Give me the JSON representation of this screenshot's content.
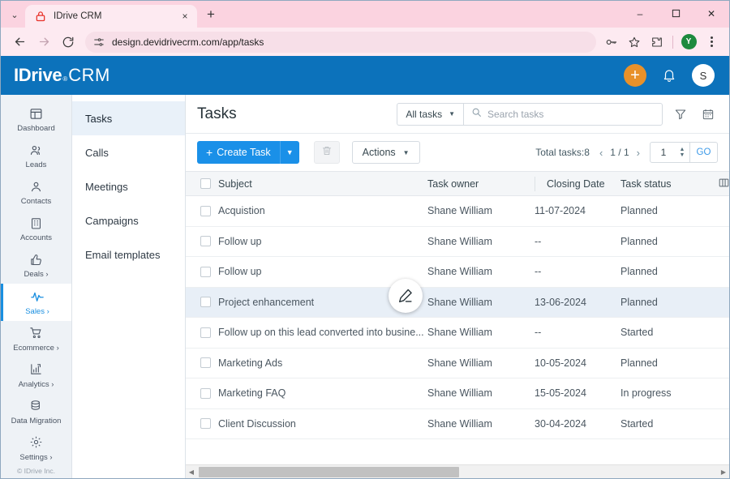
{
  "browser": {
    "tab": {
      "title": "IDrive CRM",
      "favicon": "idrive-lock-icon",
      "close": "×"
    },
    "new_tab": "+",
    "tab_list_chevron": "⌄",
    "window_controls": {
      "minimize": "–",
      "maximize": "☐",
      "close": "✕"
    },
    "nav": {
      "back": "←",
      "forward": "→",
      "reload": "⟳"
    },
    "omnibox": {
      "url": "design.devidrivecrm.com/app/tasks",
      "site_icon": "page-settings-icon"
    },
    "toolbar_icons": {
      "password": "key-icon",
      "bookmark": "star-icon",
      "extensions": "puzzle-icon",
      "profile_initial": "Y",
      "menu": "kebab-icon"
    }
  },
  "app_header": {
    "logo_primary": "IDrive",
    "logo_registered": "®",
    "logo_secondary": "CRM",
    "add_button": "+",
    "notifications_icon": "bell-icon",
    "user_initial": "S",
    "brand_color": "#0c72bb",
    "accent_orange": "#e8912a"
  },
  "sidebar": {
    "items": [
      {
        "label": "Dashboard",
        "icon": "dashboard-icon",
        "active": false,
        "caret": ""
      },
      {
        "label": "Leads",
        "icon": "leads-icon",
        "active": false,
        "caret": ""
      },
      {
        "label": "Contacts",
        "icon": "contacts-icon",
        "active": false,
        "caret": ""
      },
      {
        "label": "Accounts",
        "icon": "accounts-icon",
        "active": false,
        "caret": ""
      },
      {
        "label": "Deals ›",
        "icon": "deals-thumbsup-icon",
        "active": false,
        "caret": "›"
      },
      {
        "label": "Sales ›",
        "icon": "sales-pulse-icon",
        "active": true,
        "caret": "›"
      },
      {
        "label": "Ecommerce ›",
        "icon": "ecommerce-cart-icon",
        "active": false,
        "caret": "›"
      },
      {
        "label": "Analytics ›",
        "icon": "analytics-chart-icon",
        "active": false,
        "caret": "›"
      },
      {
        "label": "Data Migration",
        "icon": "data-migration-icon",
        "active": false,
        "caret": ""
      },
      {
        "label": "Settings ›",
        "icon": "settings-gear-icon",
        "active": false,
        "caret": "›"
      }
    ],
    "footer": "© IDrive Inc."
  },
  "subnav": {
    "items": [
      {
        "label": "Tasks",
        "active": true
      },
      {
        "label": "Calls",
        "active": false
      },
      {
        "label": "Meetings",
        "active": false
      },
      {
        "label": "Campaigns",
        "active": false
      },
      {
        "label": "Email templates",
        "active": false
      }
    ]
  },
  "main": {
    "title": "Tasks",
    "filter_select": {
      "value": "All tasks",
      "caret": "▼"
    },
    "search": {
      "value": "",
      "placeholder": "Search tasks",
      "icon": "search-icon"
    },
    "filter_icon": "funnel-filter-icon",
    "calendar_icon": "calendar-icon",
    "toolbar": {
      "create_label": "Create Task",
      "create_plus": "+",
      "create_caret": "▼",
      "delete_icon": "trash-icon",
      "actions_label": "Actions",
      "actions_caret": "▼"
    },
    "pagination": {
      "total_label": "Total tasks:",
      "total_count": "8",
      "prev": "‹",
      "page_indicator": "1 / 1",
      "next": "›",
      "page_value": "1",
      "spin_up": "▲",
      "spin_down": "▼",
      "go_label": "GO"
    },
    "table": {
      "columns": [
        "Subject",
        "Task owner",
        "Closing Date",
        "Task status"
      ],
      "column_settings_icon": "column-layout-icon",
      "rows": [
        {
          "subject": "Acquistion",
          "owner": "Shane William",
          "closing_date": "11-07-2024",
          "status": "Planned",
          "hovered": false
        },
        {
          "subject": "Follow up",
          "owner": "Shane William",
          "closing_date": "--",
          "status": "Planned",
          "hovered": false
        },
        {
          "subject": "Follow up",
          "owner": "Shane William",
          "closing_date": "--",
          "status": "Planned",
          "hovered": false
        },
        {
          "subject": "Project enhancement",
          "owner": "Shane William",
          "closing_date": "13-06-2024",
          "status": "Planned",
          "hovered": true
        },
        {
          "subject": "Follow up on this lead converted into busine...",
          "owner": "Shane William",
          "closing_date": "--",
          "status": "Started",
          "hovered": false
        },
        {
          "subject": "Marketing Ads",
          "owner": "Shane William",
          "closing_date": "10-05-2024",
          "status": "Planned",
          "hovered": false
        },
        {
          "subject": "Marketing FAQ",
          "owner": "Shane William",
          "closing_date": "15-05-2024",
          "status": "In progress",
          "hovered": false
        },
        {
          "subject": "Client Discussion",
          "owner": "Shane William",
          "closing_date": "30-04-2024",
          "status": "Started",
          "hovered": false
        }
      ]
    },
    "cursor_icon": "edit-pencil-cursor",
    "scrollbar": {
      "left_arrow": "◀",
      "right_arrow": "▶"
    }
  }
}
